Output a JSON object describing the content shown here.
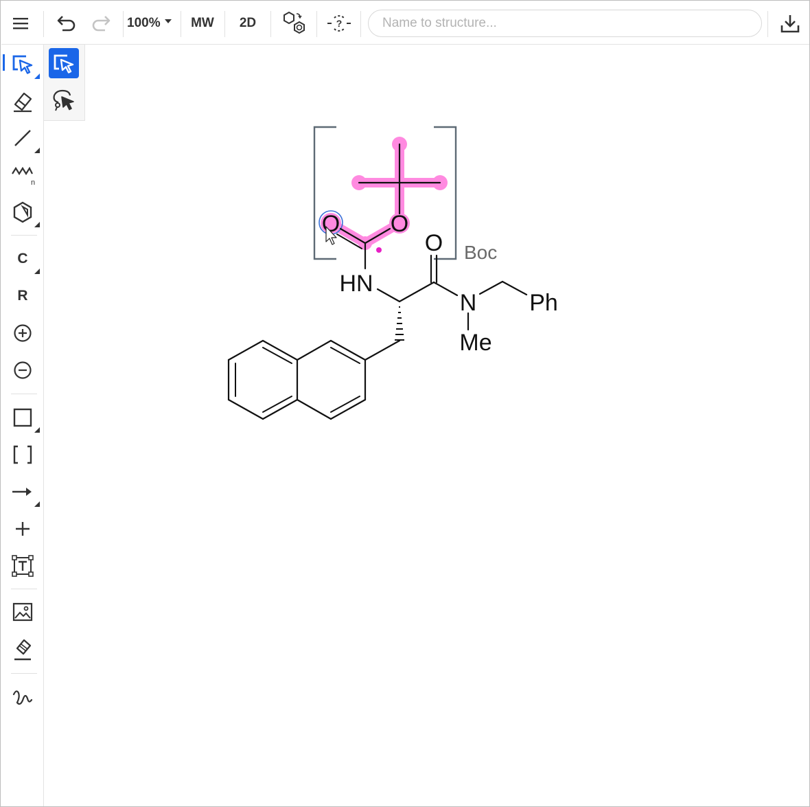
{
  "toolbar": {
    "zoom": "100%",
    "mw_label": "MW",
    "layout_label": "2D",
    "search_placeholder": "Name to structure..."
  },
  "left_tools": {
    "carbon_label": "C",
    "rgroup_label": "R"
  },
  "canvas": {
    "atoms": {
      "o_carbonyl_boc": "O",
      "o_ether_boc": "O",
      "o_amide": "O",
      "hn": "HN",
      "n_amide": "N",
      "me": "Me",
      "ph": "Ph"
    },
    "sgroup_label": "Boc"
  },
  "colors": {
    "accent": "#1a66e8",
    "highlight": "#ff8ae0",
    "highlight_dot": "#e81fc5",
    "bracket": "#5e6a75"
  }
}
